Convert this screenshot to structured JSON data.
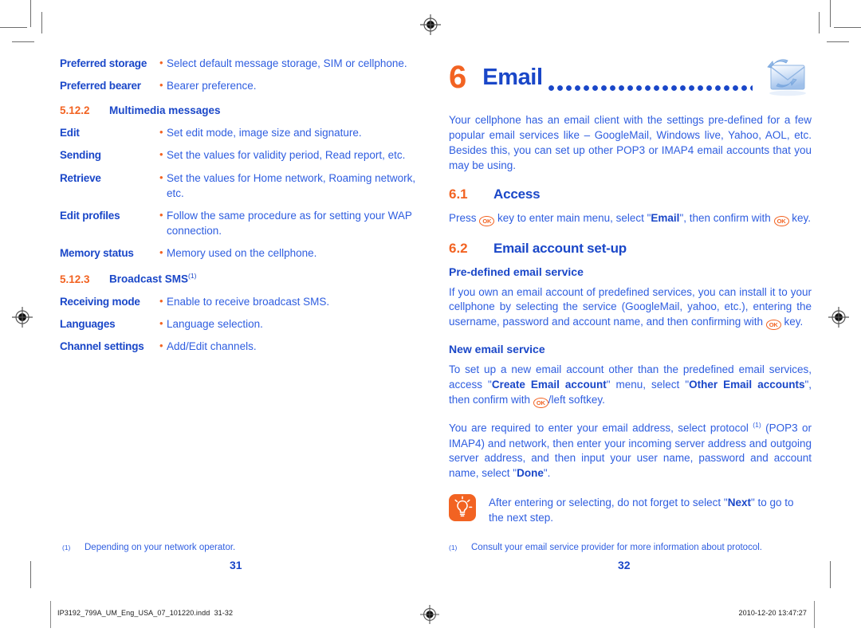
{
  "left_column": {
    "rows_top": [
      {
        "term": "Preferred storage",
        "bullet": "•",
        "desc": "Select default message storage, SIM or cellphone."
      },
      {
        "term": "Preferred bearer",
        "bullet": "•",
        "desc": "Bearer preference."
      }
    ],
    "section_mms": {
      "num": "5.12.2",
      "title": "Multimedia messages"
    },
    "rows_mms": [
      {
        "term": "Edit",
        "bullet": "•",
        "desc": "Set edit mode, image size and signature."
      },
      {
        "term": "Sending",
        "bullet": "•",
        "desc": "Set the values for validity period, Read report, etc."
      },
      {
        "term": "Retrieve",
        "bullet": "•",
        "desc": "Set the values for Home network, Roaming network, etc."
      },
      {
        "term": "Edit profiles",
        "bullet": "•",
        "desc": "Follow the same procedure as for setting your WAP connection."
      },
      {
        "term": "Memory status",
        "bullet": "•",
        "desc": "Memory used on the cellphone."
      }
    ],
    "section_broadcast": {
      "num": "5.12.3",
      "title": "Broadcast SMS",
      "footnote_mark": "(1)"
    },
    "rows_broadcast": [
      {
        "term": "Receiving mode",
        "bullet": "•",
        "desc": "Enable to receive broadcast SMS."
      },
      {
        "term": "Languages",
        "bullet": "•",
        "desc": "Language selection."
      },
      {
        "term": "Channel settings",
        "bullet": "•",
        "desc": "Add/Edit channels."
      }
    ],
    "footnote": {
      "mark": "(1)",
      "text": "Depending on your network operator."
    },
    "page_number": "31"
  },
  "right_column": {
    "chapter": {
      "number": "6",
      "title": "Email",
      "icon": "email-sync-envelope-icon"
    },
    "intro": "Your cellphone has an email client with the settings pre-defined for a few popular email services like – GoogleMail, Windows live, Yahoo, AOL, etc. Besides this, you can set up other POP3 or IMAP4 email accounts that you may be using.",
    "section_access": {
      "num": "6.1",
      "title": "Access"
    },
    "access_text": {
      "part1": "Press ",
      "key1": "OK",
      "part2": " key to enter main menu, select \"",
      "bold1": "Email",
      "part3": "\", then confirm with ",
      "key2": "OK",
      "part4": " key."
    },
    "section_setup": {
      "num": "6.2",
      "title": "Email account set-up"
    },
    "subsection_predefined": "Pre-defined email service",
    "predefined_text": {
      "part1": "If you own an email account of predefined services, you can install it to your cellphone by selecting the service (GoogleMail, yahoo, etc.), entering the username, password and account name, and then confirming with ",
      "key1": "OK",
      "part2": " key."
    },
    "subsection_new": "New email service",
    "new_text": {
      "part1": "To set up a new email account other than the predefined email services, access \"",
      "bold1": "Create Email account",
      "part2": "\" menu, select \"",
      "bold2": "Other Email accounts",
      "part3": "\", then confirm with ",
      "key1": "OK",
      "part4": "/left softkey."
    },
    "required_text": {
      "part1": "You are required to enter your email address, select protocol ",
      "footnote_mark": "(1)",
      "part2": " (POP3 or IMAP4) and network, then enter your incoming server address and outgoing server address, and then input your user name, password and account name, select \"",
      "bold1": "Done",
      "part3": "\"."
    },
    "tip": {
      "icon": "lightbulb-tip-icon",
      "part1": "After entering or selecting, do not forget to select \"",
      "bold1": "Next",
      "part2": "\" to go to the next step."
    },
    "footnote": {
      "mark": "(1)",
      "text": "Consult your email service provider for more information about protocol."
    },
    "page_number": "32"
  },
  "print_slug": {
    "filename": "IP3192_799A_UM_Eng_USA_07_101220.indd",
    "pages": "31-32",
    "timestamp": "2010-12-20  13:47:27"
  },
  "colors": {
    "orange": "#f26322",
    "blue_heading": "#1a47c8",
    "blue_body": "#2f5ee0"
  }
}
